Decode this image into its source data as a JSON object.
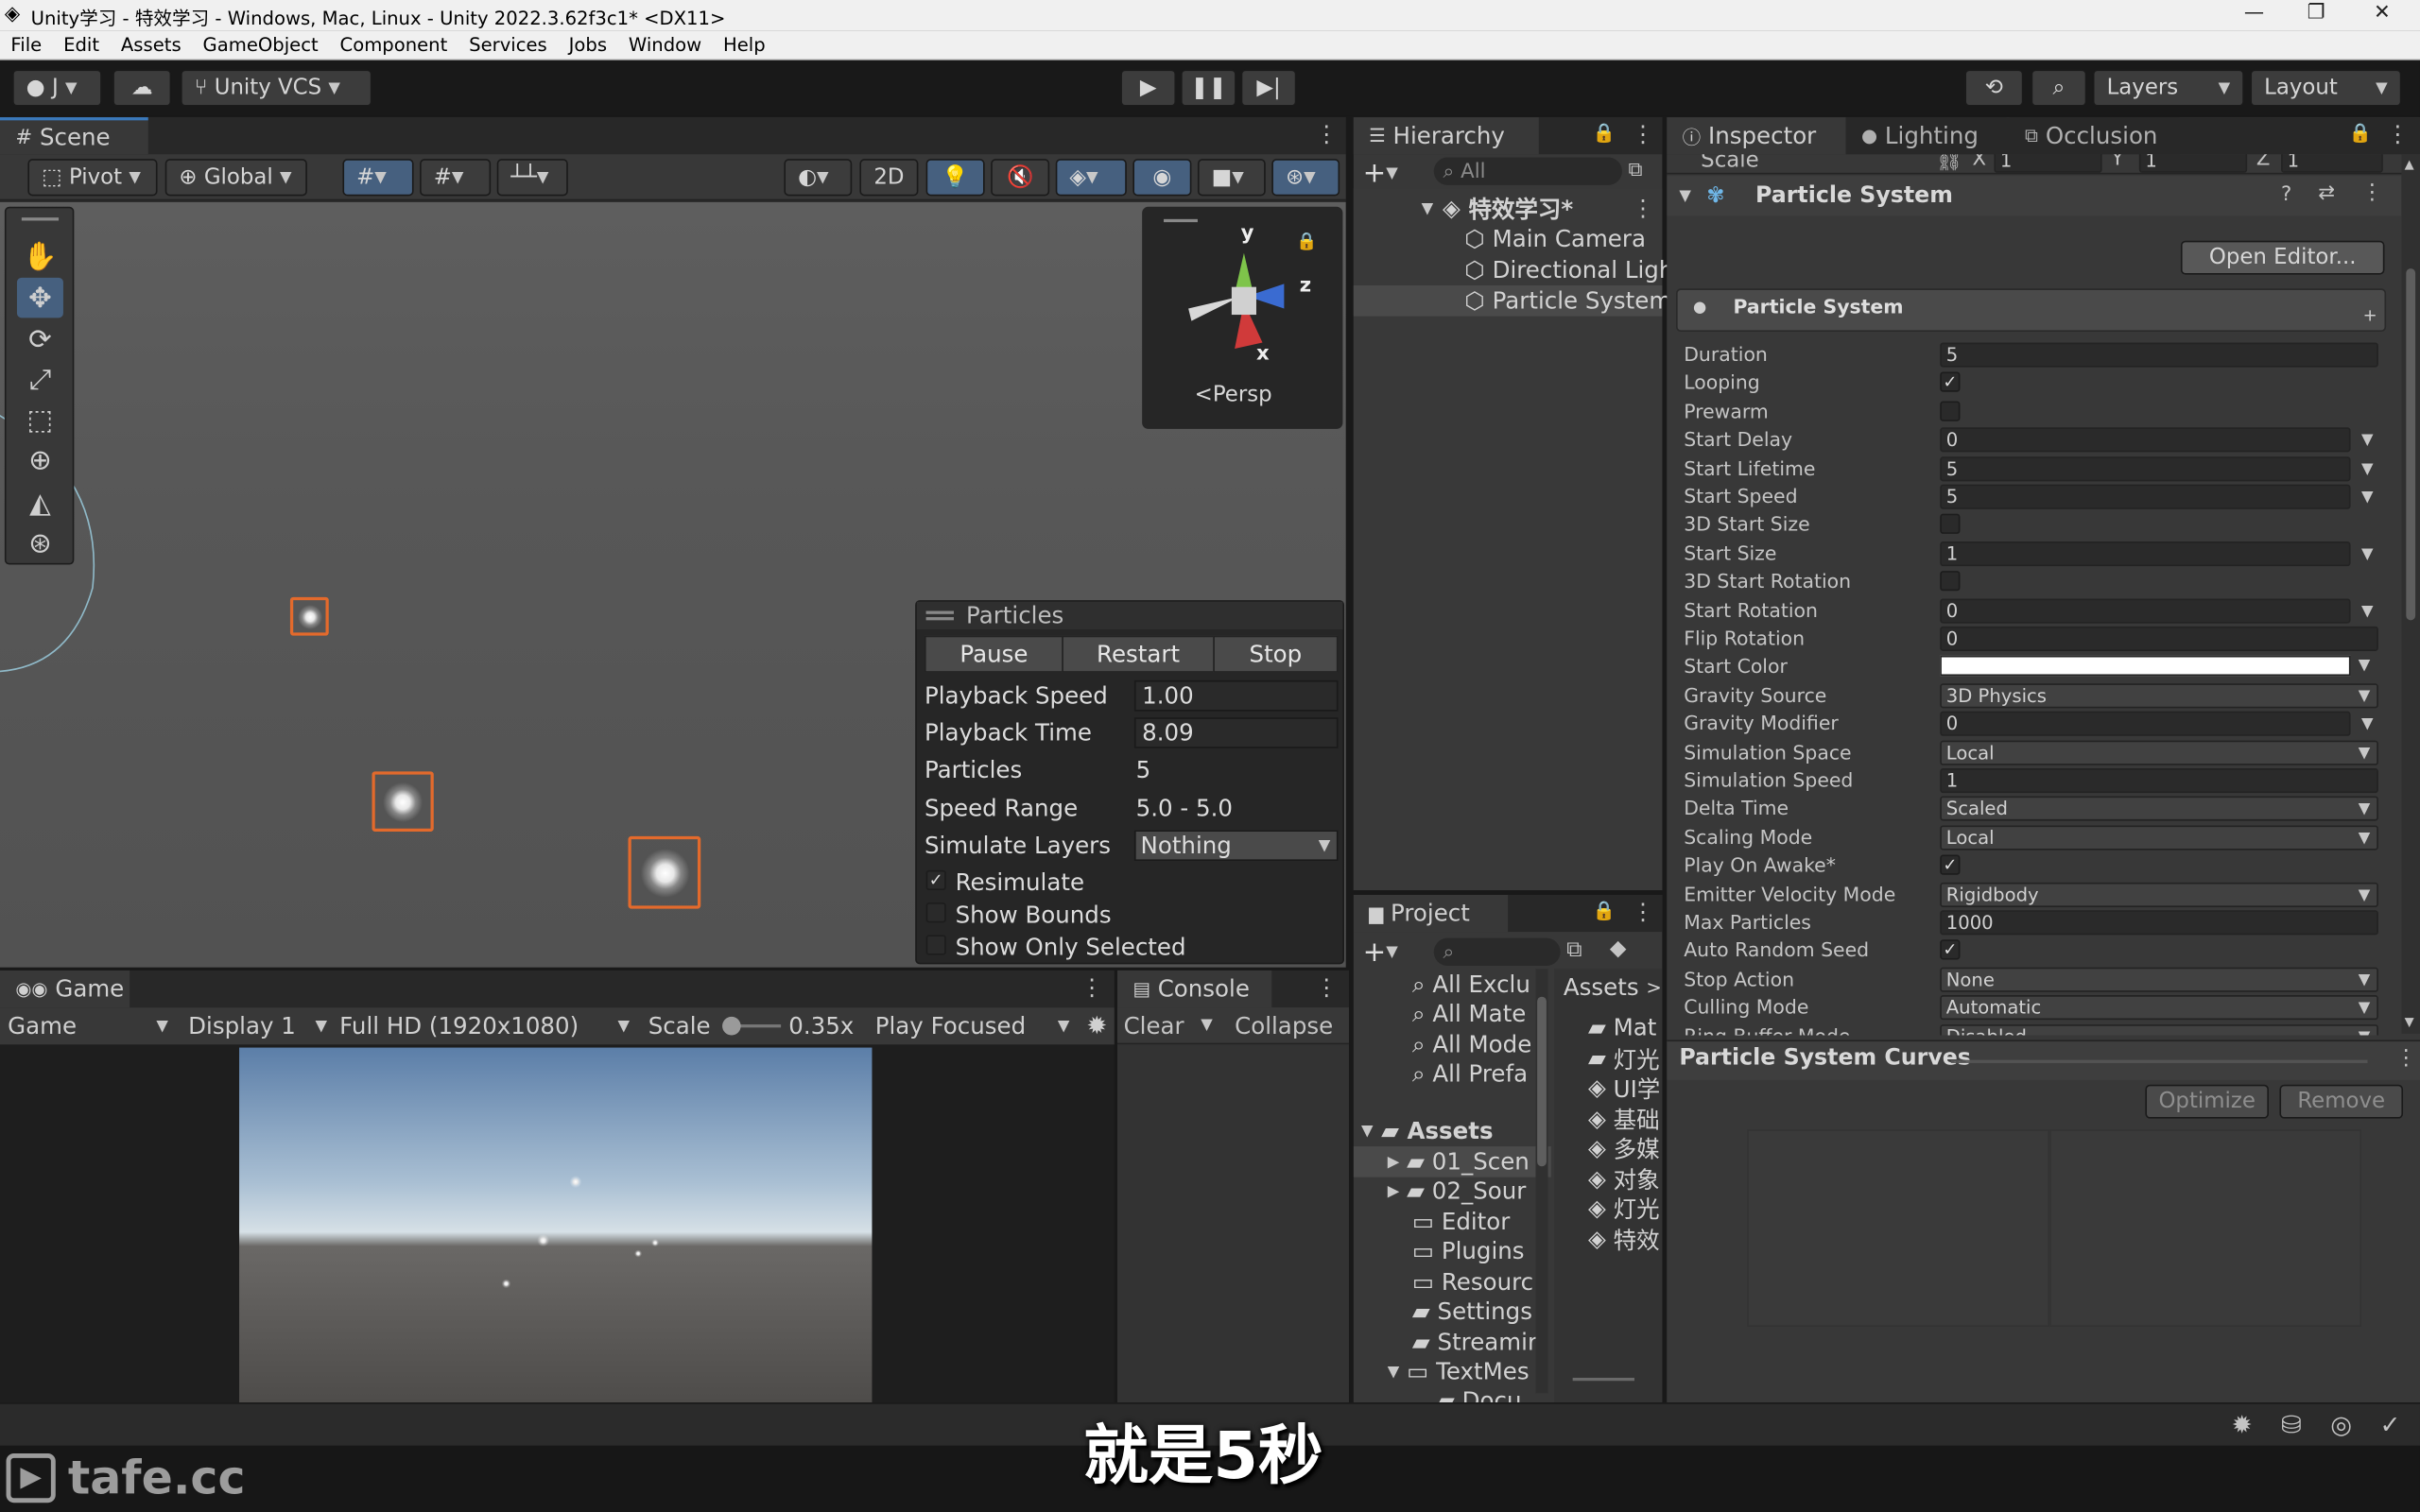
{
  "window": {
    "title": "Unity学习 - 特效学习 - Windows, Mac, Linux - Unity 2022.3.62f3c1* <DX11>",
    "minimize": "—",
    "maximize": "❐",
    "close": "✕"
  },
  "menu": [
    "File",
    "Edit",
    "Assets",
    "GameObject",
    "Component",
    "Services",
    "Jobs",
    "Window",
    "Help"
  ],
  "toolbar": {
    "account": "J",
    "vcs": "Unity VCS",
    "layers": "Layers",
    "layout": "Layout"
  },
  "scene": {
    "tab": "Scene",
    "pivot": "Pivot",
    "global": "Global",
    "mode2d": "2D",
    "persp": "Persp",
    "axis_y": "y",
    "axis_z": "z",
    "axis_x": "x"
  },
  "particles": {
    "title": "Particles",
    "pause": "Pause",
    "restart": "Restart",
    "stop": "Stop",
    "rows": [
      {
        "label": "Playback Speed",
        "value": "1.00"
      },
      {
        "label": "Playback Time",
        "value": "8.09"
      },
      {
        "label": "Particles",
        "value": "5"
      },
      {
        "label": "Speed Range",
        "value": "5.0 - 5.0"
      },
      {
        "label": "Simulate Layers",
        "value": "Nothing"
      }
    ],
    "resimulate": "Resimulate",
    "show_bounds": "Show Bounds",
    "show_only_selected": "Show Only Selected"
  },
  "game": {
    "tab": "Game",
    "mode": "Game",
    "display": "Display 1",
    "resolution": "Full HD (1920x1080)",
    "scale_label": "Scale",
    "scale_value": "0.35x",
    "play_focused": "Play Focused"
  },
  "console": {
    "tab": "Console",
    "clear": "Clear",
    "collapse": "Collapse"
  },
  "hierarchy": {
    "tab": "Hierarchy",
    "search_placeholder": "All",
    "scene": "特效学习*",
    "items": [
      "Main Camera",
      "Directional Ligh",
      "Particle System"
    ]
  },
  "project": {
    "tab": "Project",
    "favorites": [
      "All Exclu",
      "All Mate",
      "All Mode",
      "All Prefa"
    ],
    "assets_root": "Assets",
    "folders": [
      "01_Scen",
      "02_Sour",
      "Editor",
      "Plugins",
      "Resourc",
      "Settings",
      "Streamir",
      "TextMes",
      "Docu"
    ],
    "breadcrumb": "Assets",
    "right_items": [
      "Mat",
      "灯光",
      "UI学",
      "基础",
      "多媒",
      "对象",
      "灯光",
      "特效"
    ]
  },
  "inspector": {
    "tabs": [
      "Inspector",
      "Lighting",
      "Occlusion"
    ],
    "scale_label": "Scale",
    "scale_x": "1",
    "scale_y": "1",
    "scale_z": "1",
    "x": "X",
    "y": "Y",
    "z": "Z",
    "component": "Particle System",
    "open_editor": "Open Editor...",
    "module": "Particle System",
    "rows": [
      {
        "label": "Duration",
        "type": "field",
        "value": "5"
      },
      {
        "label": "Looping",
        "type": "check",
        "value": "✓"
      },
      {
        "label": "Prewarm",
        "type": "check",
        "value": ""
      },
      {
        "label": "Start Delay",
        "type": "curve",
        "value": "0"
      },
      {
        "label": "Start Lifetime",
        "type": "curve",
        "value": "5"
      },
      {
        "label": "Start Speed",
        "type": "curve",
        "value": "5"
      },
      {
        "label": "3D Start Size",
        "type": "check",
        "value": ""
      },
      {
        "label": "Start Size",
        "type": "curve",
        "value": "1"
      },
      {
        "label": "3D Start Rotation",
        "type": "check",
        "value": ""
      },
      {
        "label": "Start Rotation",
        "type": "curve",
        "value": "0"
      },
      {
        "label": "Flip Rotation",
        "type": "field",
        "value": "0"
      },
      {
        "label": "Start Color",
        "type": "color",
        "value": ""
      },
      {
        "label": "Gravity Source",
        "type": "dropdown",
        "value": "3D Physics"
      },
      {
        "label": "Gravity Modifier",
        "type": "curve",
        "value": "0"
      },
      {
        "label": "Simulation Space",
        "type": "dropdown",
        "value": "Local"
      },
      {
        "label": "Simulation Speed",
        "type": "field",
        "value": "1"
      },
      {
        "label": "Delta Time",
        "type": "dropdown",
        "value": "Scaled"
      },
      {
        "label": "Scaling Mode",
        "type": "dropdown",
        "value": "Local"
      },
      {
        "label": "Play On Awake*",
        "type": "check",
        "value": "✓"
      },
      {
        "label": "Emitter Velocity Mode",
        "type": "dropdown",
        "value": "Rigidbody"
      },
      {
        "label": "Max Particles",
        "type": "field",
        "value": "1000"
      },
      {
        "label": "Auto Random Seed",
        "type": "check",
        "value": "✓"
      },
      {
        "label": "Stop Action",
        "type": "dropdown",
        "value": "None"
      },
      {
        "label": "Culling Mode",
        "type": "dropdown",
        "value": "Automatic"
      },
      {
        "label": "Ring Buffer Mode",
        "type": "dropdown",
        "value": "Disabled"
      }
    ],
    "curves_title": "Particle System Curves",
    "optimize": "Optimize",
    "remove": "Remove"
  },
  "overlay": {
    "subtitle": "就是5秒",
    "watermark": "tafe.cc"
  },
  "colors": {
    "accent_select": "#e36a2c",
    "play_blue": "#3a79bb"
  }
}
